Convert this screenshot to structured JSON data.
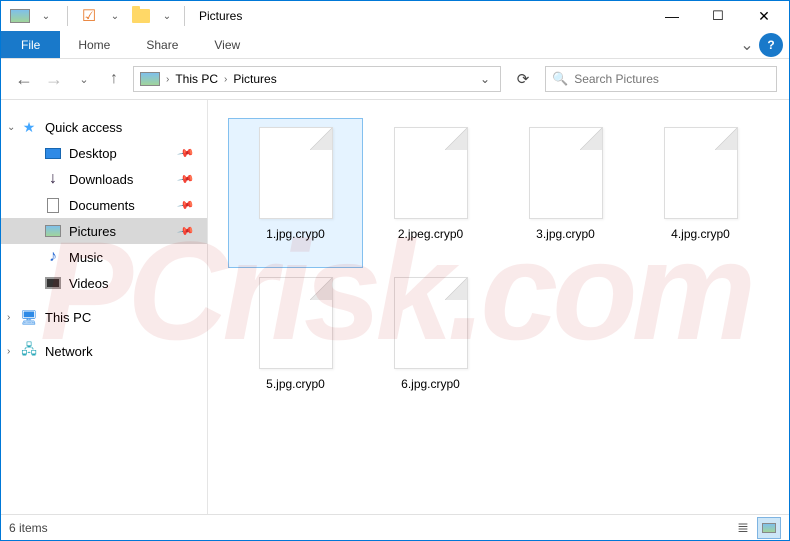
{
  "title": "Pictures",
  "watermark_text": "PCrisk.com",
  "ribbon": {
    "file": "File",
    "tabs": [
      "Home",
      "Share",
      "View"
    ]
  },
  "breadcrumb": {
    "parts": [
      "This PC",
      "Pictures"
    ]
  },
  "search": {
    "placeholder": "Search Pictures"
  },
  "sidebar": {
    "quick_access": {
      "label": "Quick access",
      "items": [
        {
          "label": "Desktop",
          "pinned": true
        },
        {
          "label": "Downloads",
          "pinned": true
        },
        {
          "label": "Documents",
          "pinned": true
        },
        {
          "label": "Pictures",
          "pinned": true,
          "selected": true
        },
        {
          "label": "Music",
          "pinned": false
        },
        {
          "label": "Videos",
          "pinned": false
        }
      ]
    },
    "this_pc": {
      "label": "This PC"
    },
    "network": {
      "label": "Network"
    }
  },
  "files": [
    {
      "name": "1.jpg.cryp0",
      "selected": true
    },
    {
      "name": "2.jpeg.cryp0",
      "selected": false
    },
    {
      "name": "3.jpg.cryp0",
      "selected": false
    },
    {
      "name": "4.jpg.cryp0",
      "selected": false
    },
    {
      "name": "5.jpg.cryp0",
      "selected": false
    },
    {
      "name": "6.jpg.cryp0",
      "selected": false
    }
  ],
  "status": {
    "text": "6 items"
  },
  "icons": {
    "checkbox": "☑",
    "chevron_right": "›",
    "chevron_down": "⌄",
    "back": "←",
    "forward": "→",
    "up": "↑",
    "refresh": "⟳",
    "search": "🔍",
    "help": "?",
    "minimize": "—",
    "maximize": "☐",
    "close": "✕",
    "dropdown": "⌄",
    "collapse": "⌄",
    "pin": "📌",
    "star": "★",
    "download": "↓",
    "music": "♪",
    "monitor": "🖥",
    "network": "🖧",
    "details_view": "≣",
    "icons_view": "▦"
  }
}
